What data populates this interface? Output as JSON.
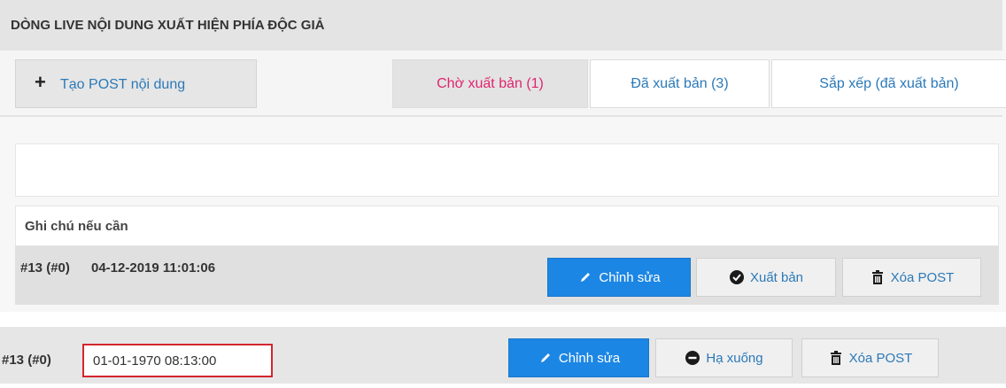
{
  "header": {
    "title": "DÒNG LIVE NỘI DUNG XUẤT HIỆN PHÍA ĐỘC GIẢ"
  },
  "toolbar": {
    "create_icon": "plus-icon",
    "create_label": "Tạo POST nội dung",
    "tabs": [
      {
        "label": "Chờ xuất bản (1)",
        "active": true
      },
      {
        "label": "Đã xuất bản (3)"
      },
      {
        "label": "Sắp xếp (đã xuất bản)"
      }
    ]
  },
  "post": {
    "note_placeholder": "Ghi chú nếu cần",
    "id": "#13 (#0)",
    "timestamp": "04-12-2019 11:01:06",
    "edit_label": "Chỉnh sửa",
    "publish_label": "Xuất bản",
    "delete_label": "Xóa POST"
  },
  "published_post": {
    "id": "#13 (#0)",
    "date_value": "01-01-1970 08:13:00",
    "edit_label": "Chỉnh sửa",
    "unpublish_label": "Hạ xuống",
    "delete_label": "Xóa POST"
  },
  "colors": {
    "primary": "#1c86e4",
    "link": "#2b79b8",
    "active_tab": "#e0246e",
    "date_border": "#d3262e"
  }
}
